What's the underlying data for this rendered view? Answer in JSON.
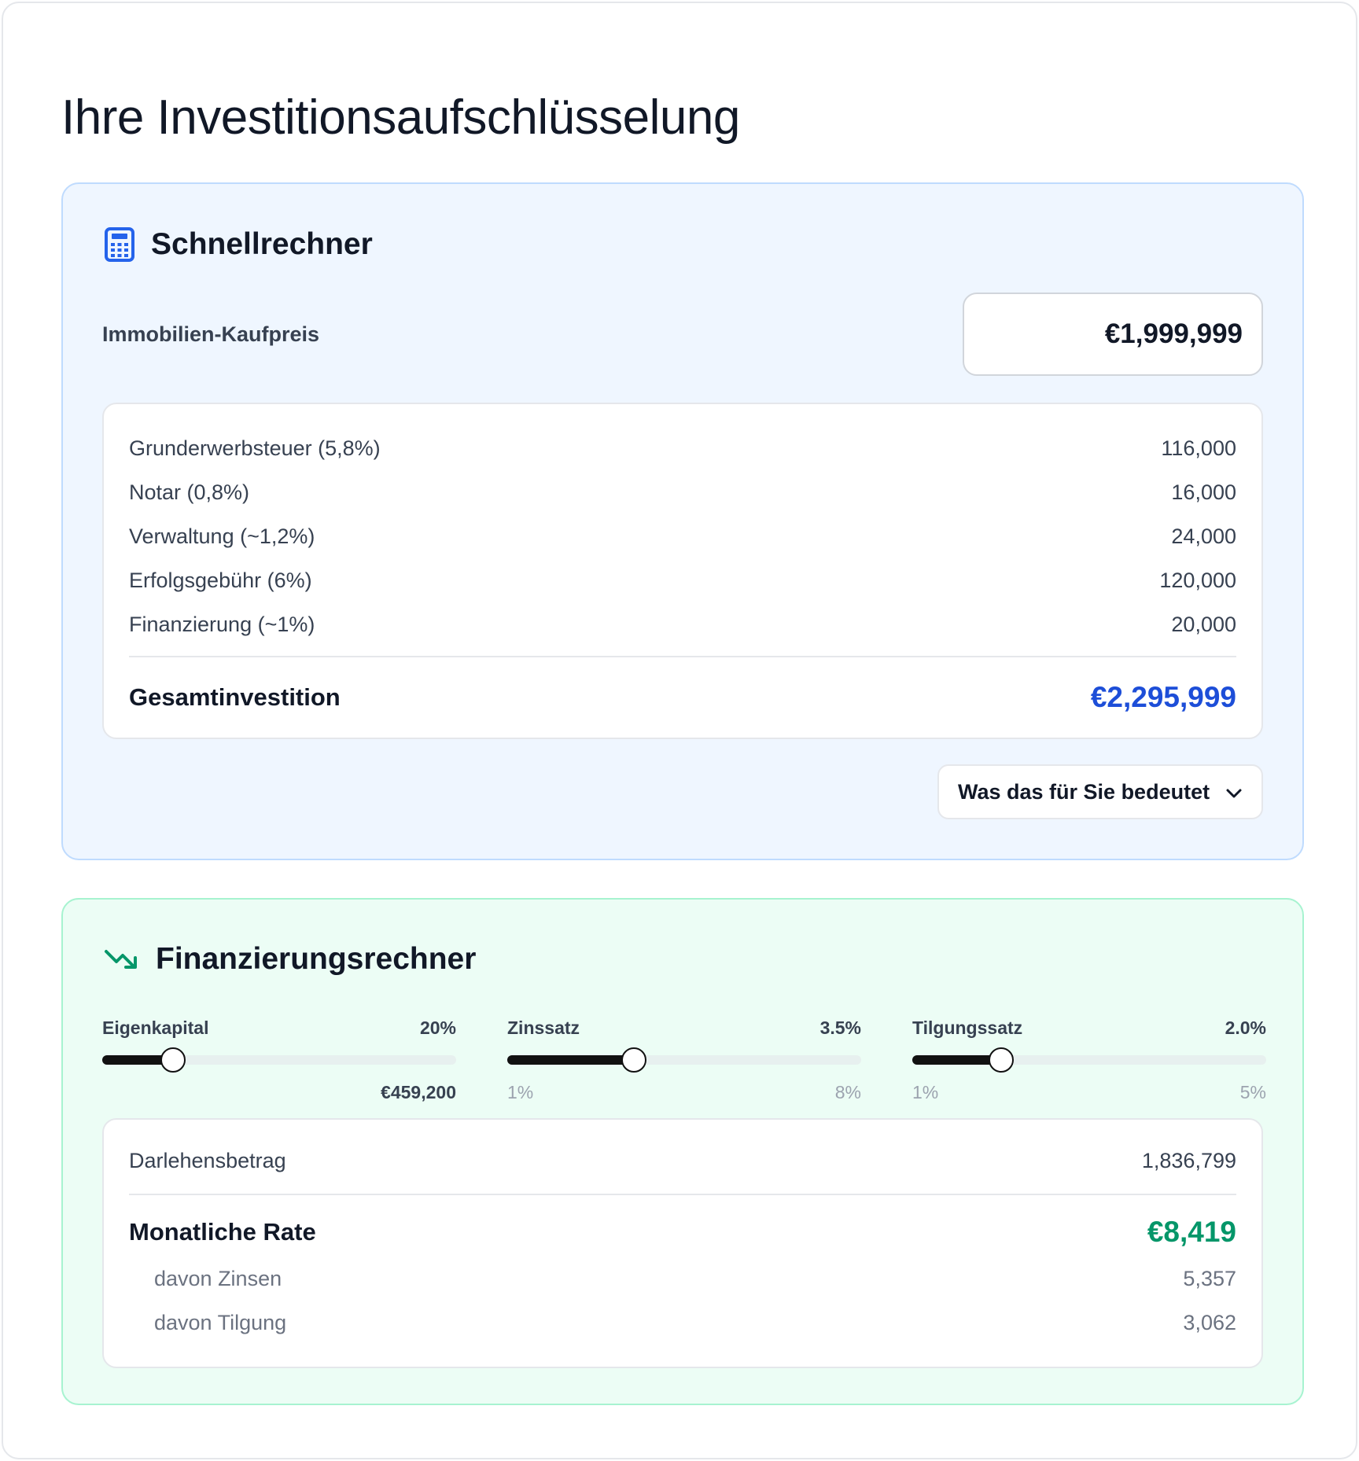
{
  "page": {
    "title": "Ihre Investitionsaufschlüsselung"
  },
  "quick_calc": {
    "title": "Schnellrechner",
    "icon": "calculator-icon",
    "price_label": "Immobilien-Kaufpreis",
    "price_value": "€1,999,999",
    "costs": [
      {
        "label": "Grunderwerbsteuer (5,8%)",
        "value": "116,000"
      },
      {
        "label": "Notar (0,8%)",
        "value": "16,000"
      },
      {
        "label": "Verwaltung (~1,2%)",
        "value": "24,000"
      },
      {
        "label": "Erfolgsgebühr (6%)",
        "value": "120,000"
      },
      {
        "label": "Finanzierung (~1%)",
        "value": "20,000"
      }
    ],
    "total_label": "Gesamtinvestition",
    "total_value": "€2,295,999",
    "toggle_label": "Was das für Sie bedeutet",
    "accent_color": "#1d4ed8"
  },
  "finance_calc": {
    "title": "Finanzierungsrechner",
    "icon": "trending-down-icon",
    "sliders": [
      {
        "label": "Eigenkapital",
        "value_label": "20%",
        "fraction": 0.2,
        "foot_left": "",
        "foot_right": "€459,200"
      },
      {
        "label": "Zinssatz",
        "value_label": "3.5%",
        "fraction": 0.3571,
        "foot_left": "1%",
        "foot_right": "8%"
      },
      {
        "label": "Tilgungssatz",
        "value_label": "2.0%",
        "fraction": 0.25,
        "foot_left": "1%",
        "foot_right": "5%"
      }
    ],
    "loan_label": "Darlehensbetrag",
    "loan_value": "1,836,799",
    "rate_label": "Monatliche Rate",
    "rate_value": "€8,419",
    "interest_label": "davon Zinsen",
    "interest_value": "5,357",
    "repayment_label": "davon Tilgung",
    "repayment_value": "3,062",
    "accent_color": "#059669"
  }
}
